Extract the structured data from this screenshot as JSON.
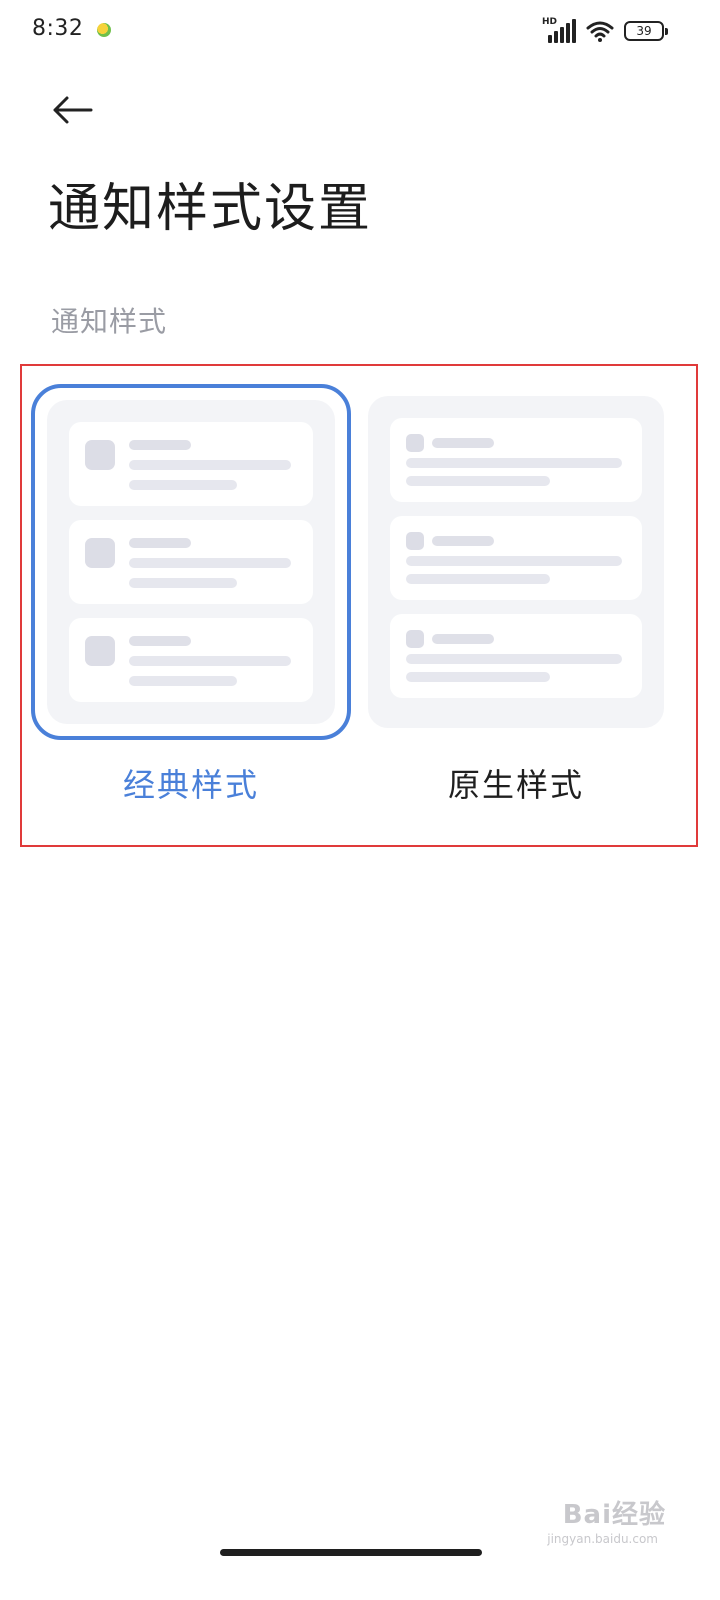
{
  "status_bar": {
    "time": "8:32",
    "network_label": "HD",
    "battery_level": "39"
  },
  "header": {
    "back_icon": "arrow-left-icon",
    "title": "通知样式设置"
  },
  "section": {
    "label": "通知样式"
  },
  "options": [
    {
      "label": "经典样式",
      "selected": true
    },
    {
      "label": "原生样式",
      "selected": false
    }
  ],
  "watermark": {
    "text": "Bai经验",
    "subtext": "jingyan.baidu.com"
  },
  "colors": {
    "accent": "#4a80d9",
    "highlight_box": "#e03a3a",
    "section_label": "#9a9ca4",
    "preview_bg": "#f3f4f7"
  }
}
